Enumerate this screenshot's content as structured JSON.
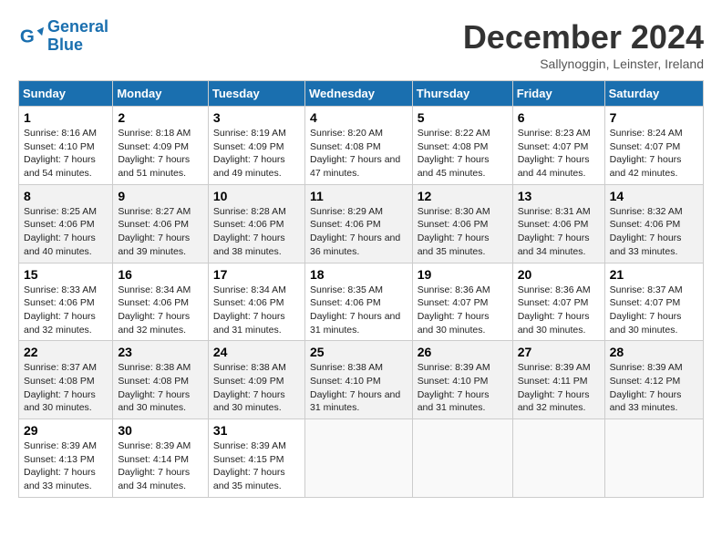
{
  "header": {
    "logo_line1": "General",
    "logo_line2": "Blue",
    "month_title": "December 2024",
    "subtitle": "Sallynoggin, Leinster, Ireland"
  },
  "days_of_week": [
    "Sunday",
    "Monday",
    "Tuesday",
    "Wednesday",
    "Thursday",
    "Friday",
    "Saturday"
  ],
  "weeks": [
    [
      {
        "day": "1",
        "sunrise": "8:16 AM",
        "sunset": "4:10 PM",
        "daylight": "7 hours and 54 minutes."
      },
      {
        "day": "2",
        "sunrise": "8:18 AM",
        "sunset": "4:09 PM",
        "daylight": "7 hours and 51 minutes."
      },
      {
        "day": "3",
        "sunrise": "8:19 AM",
        "sunset": "4:09 PM",
        "daylight": "7 hours and 49 minutes."
      },
      {
        "day": "4",
        "sunrise": "8:20 AM",
        "sunset": "4:08 PM",
        "daylight": "7 hours and 47 minutes."
      },
      {
        "day": "5",
        "sunrise": "8:22 AM",
        "sunset": "4:08 PM",
        "daylight": "7 hours and 45 minutes."
      },
      {
        "day": "6",
        "sunrise": "8:23 AM",
        "sunset": "4:07 PM",
        "daylight": "7 hours and 44 minutes."
      },
      {
        "day": "7",
        "sunrise": "8:24 AM",
        "sunset": "4:07 PM",
        "daylight": "7 hours and 42 minutes."
      }
    ],
    [
      {
        "day": "8",
        "sunrise": "8:25 AM",
        "sunset": "4:06 PM",
        "daylight": "7 hours and 40 minutes."
      },
      {
        "day": "9",
        "sunrise": "8:27 AM",
        "sunset": "4:06 PM",
        "daylight": "7 hours and 39 minutes."
      },
      {
        "day": "10",
        "sunrise": "8:28 AM",
        "sunset": "4:06 PM",
        "daylight": "7 hours and 38 minutes."
      },
      {
        "day": "11",
        "sunrise": "8:29 AM",
        "sunset": "4:06 PM",
        "daylight": "7 hours and 36 minutes."
      },
      {
        "day": "12",
        "sunrise": "8:30 AM",
        "sunset": "4:06 PM",
        "daylight": "7 hours and 35 minutes."
      },
      {
        "day": "13",
        "sunrise": "8:31 AM",
        "sunset": "4:06 PM",
        "daylight": "7 hours and 34 minutes."
      },
      {
        "day": "14",
        "sunrise": "8:32 AM",
        "sunset": "4:06 PM",
        "daylight": "7 hours and 33 minutes."
      }
    ],
    [
      {
        "day": "15",
        "sunrise": "8:33 AM",
        "sunset": "4:06 PM",
        "daylight": "7 hours and 32 minutes."
      },
      {
        "day": "16",
        "sunrise": "8:34 AM",
        "sunset": "4:06 PM",
        "daylight": "7 hours and 32 minutes."
      },
      {
        "day": "17",
        "sunrise": "8:34 AM",
        "sunset": "4:06 PM",
        "daylight": "7 hours and 31 minutes."
      },
      {
        "day": "18",
        "sunrise": "8:35 AM",
        "sunset": "4:06 PM",
        "daylight": "7 hours and 31 minutes."
      },
      {
        "day": "19",
        "sunrise": "8:36 AM",
        "sunset": "4:07 PM",
        "daylight": "7 hours and 30 minutes."
      },
      {
        "day": "20",
        "sunrise": "8:36 AM",
        "sunset": "4:07 PM",
        "daylight": "7 hours and 30 minutes."
      },
      {
        "day": "21",
        "sunrise": "8:37 AM",
        "sunset": "4:07 PM",
        "daylight": "7 hours and 30 minutes."
      }
    ],
    [
      {
        "day": "22",
        "sunrise": "8:37 AM",
        "sunset": "4:08 PM",
        "daylight": "7 hours and 30 minutes."
      },
      {
        "day": "23",
        "sunrise": "8:38 AM",
        "sunset": "4:08 PM",
        "daylight": "7 hours and 30 minutes."
      },
      {
        "day": "24",
        "sunrise": "8:38 AM",
        "sunset": "4:09 PM",
        "daylight": "7 hours and 30 minutes."
      },
      {
        "day": "25",
        "sunrise": "8:38 AM",
        "sunset": "4:10 PM",
        "daylight": "7 hours and 31 minutes."
      },
      {
        "day": "26",
        "sunrise": "8:39 AM",
        "sunset": "4:10 PM",
        "daylight": "7 hours and 31 minutes."
      },
      {
        "day": "27",
        "sunrise": "8:39 AM",
        "sunset": "4:11 PM",
        "daylight": "7 hours and 32 minutes."
      },
      {
        "day": "28",
        "sunrise": "8:39 AM",
        "sunset": "4:12 PM",
        "daylight": "7 hours and 33 minutes."
      }
    ],
    [
      {
        "day": "29",
        "sunrise": "8:39 AM",
        "sunset": "4:13 PM",
        "daylight": "7 hours and 33 minutes."
      },
      {
        "day": "30",
        "sunrise": "8:39 AM",
        "sunset": "4:14 PM",
        "daylight": "7 hours and 34 minutes."
      },
      {
        "day": "31",
        "sunrise": "8:39 AM",
        "sunset": "4:15 PM",
        "daylight": "7 hours and 35 minutes."
      },
      null,
      null,
      null,
      null
    ]
  ]
}
